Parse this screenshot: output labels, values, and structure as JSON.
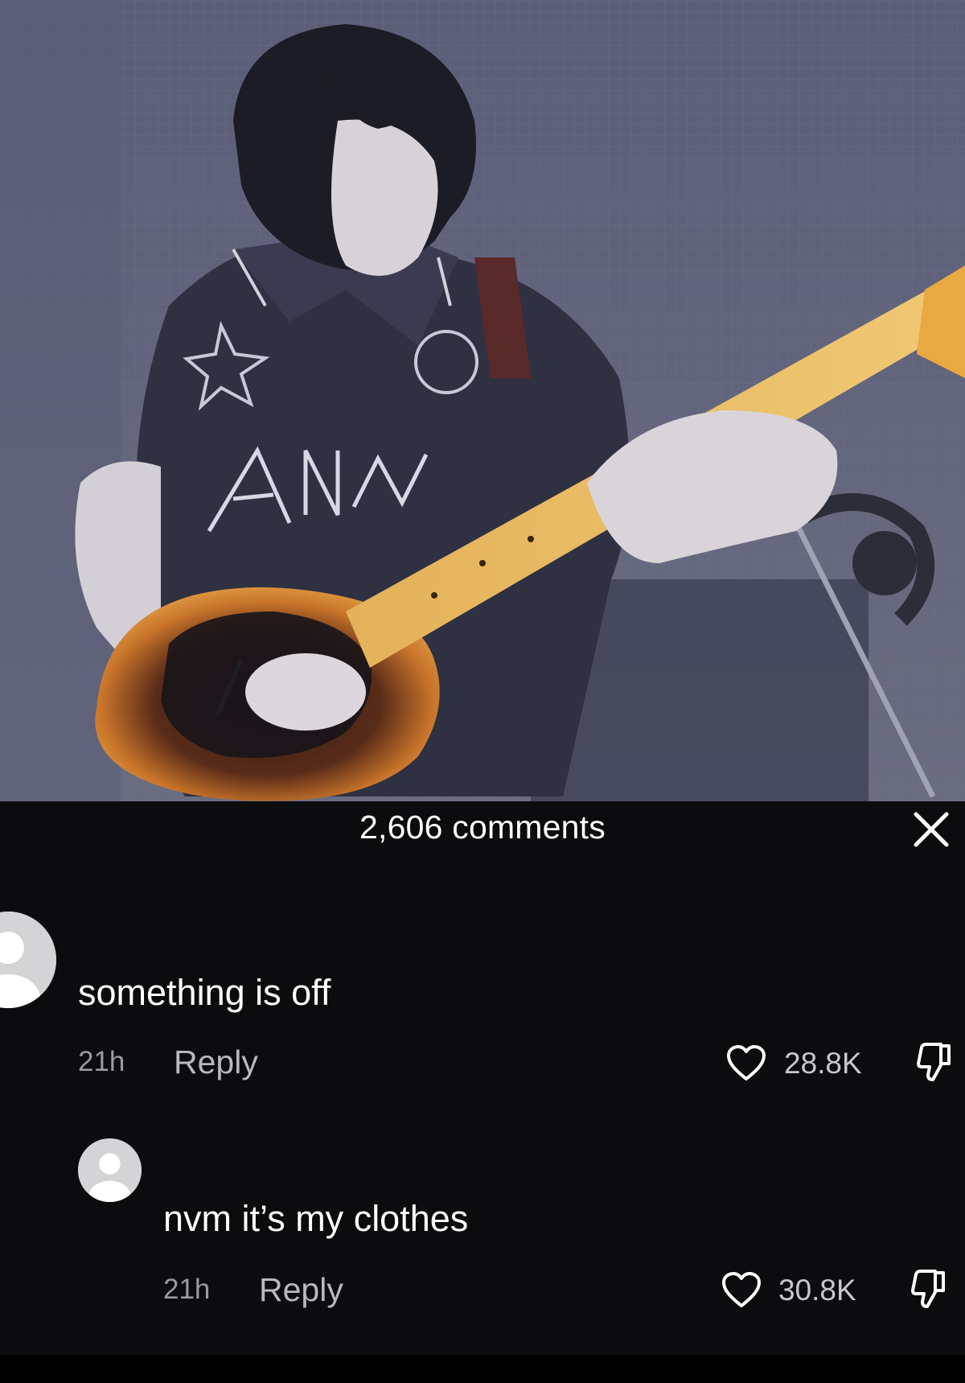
{
  "panel": {
    "title": "2,606 comments",
    "close_icon": "close-icon"
  },
  "colors": {
    "panel_background": "#0c0c0f",
    "muted_text": "#9a9a9e",
    "primary_text": "#ffffff"
  },
  "comments": [
    {
      "text": "something is off",
      "time": "21h",
      "reply_label": "Reply",
      "likes": "28.8K",
      "like_icon": "heart-outline-icon",
      "dislike_icon": "thumbs-down-icon",
      "avatar_icon": "default-avatar-icon"
    },
    {
      "text": "nvm it’s my clothes",
      "time": "21h",
      "reply_label": "Reply",
      "likes": "30.8K",
      "like_icon": "heart-outline-icon",
      "dislike_icon": "thumbs-down-icon",
      "avatar_icon": "default-avatar-icon"
    }
  ]
}
